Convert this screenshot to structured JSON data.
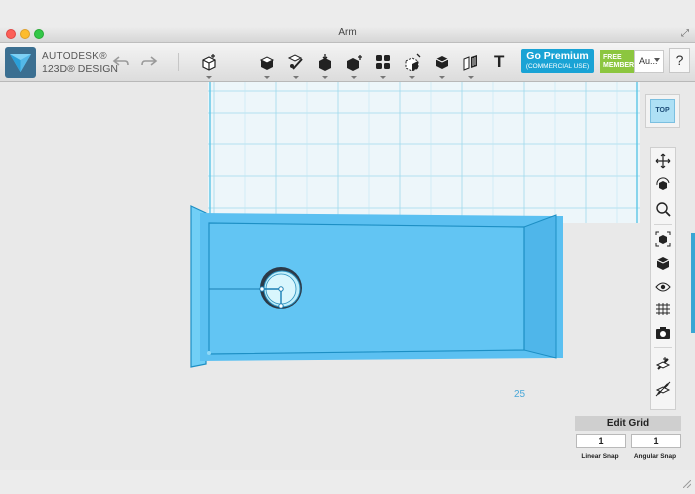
{
  "window": {
    "title": "Arm"
  },
  "logo": {
    "line1": "AUTODESK®",
    "line2": "123D® DESIGN"
  },
  "toolbar": {
    "icons": [
      "undo-icon",
      "redo-icon",
      "primitives-icon",
      "sketch-icon",
      "construct-icon",
      "modify-icon",
      "pattern-icon",
      "group-icon",
      "combine-icon",
      "measure-icon",
      "snap-icon",
      "text-icon"
    ],
    "text_tool_label": "T"
  },
  "premium": {
    "title": "Go Premium",
    "subtitle": "(COMMERCIAL USE)"
  },
  "member": {
    "line1": "FREE",
    "line2": "MEMBER"
  },
  "account": {
    "label": "Au..."
  },
  "help": {
    "label": "?"
  },
  "view_cube": {
    "label": "TOP"
  },
  "nav_panel": {
    "buttons": [
      "pan-icon",
      "orbit-icon",
      "zoom-icon",
      "fit-icon",
      "view-material-icon",
      "visibility-icon",
      "grid-visibility-icon",
      "snapshot-icon",
      "material-icon",
      "hide-icon"
    ]
  },
  "grid": {
    "size_label": "25"
  },
  "edit_grid": {
    "title": "Edit Grid",
    "linear_snap_value": "1",
    "angular_snap_value": "1",
    "linear_snap_label": "Linear Snap",
    "angular_snap_label": "Angular Snap"
  },
  "colors": {
    "accent": "#1aa3d5",
    "object_fill": "#5bc0f1",
    "object_stroke": "#1d8fc4",
    "grid_line": "#7fd0ea",
    "free_member": "#8cc63f"
  }
}
